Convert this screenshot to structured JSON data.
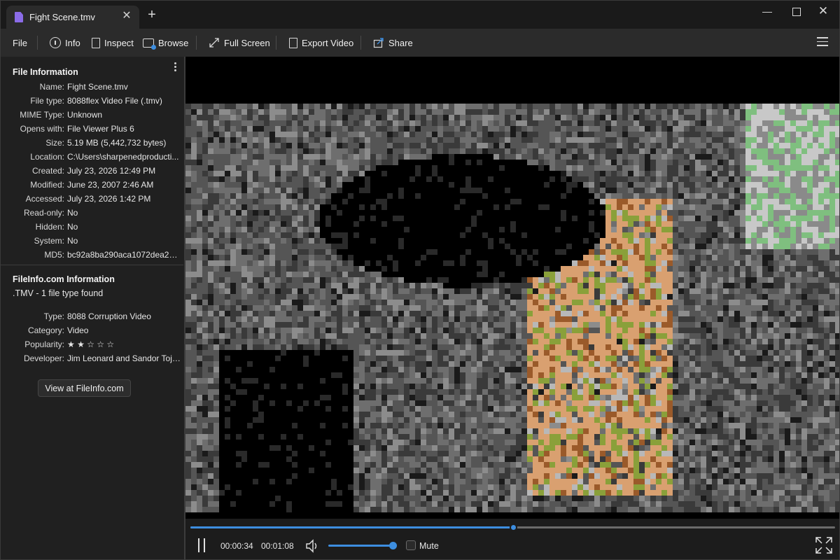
{
  "window": {
    "tab_title": "Fight Scene.tmv",
    "tab_close": "✕",
    "new_tab": "+",
    "minimize": "—",
    "close": "✕"
  },
  "toolbar": {
    "file": "File",
    "info": "Info",
    "inspect": "Inspect",
    "browse": "Browse",
    "full_screen": "Full Screen",
    "export_video": "Export Video",
    "share": "Share"
  },
  "file_info": {
    "title": "File Information",
    "rows": [
      {
        "key": "Name:",
        "value": "Fight Scene.tmv"
      },
      {
        "key": "File type:",
        "value": "8088flex Video File (.tmv)"
      },
      {
        "key": "MIME Type:",
        "value": "Unknown"
      },
      {
        "key": "Opens with:",
        "value": "File Viewer Plus 6"
      },
      {
        "key": "Size:",
        "value": "5.19 MB (5,442,732 bytes)"
      },
      {
        "key": "Location:",
        "value": "C:\\Users\\sharpenedproducti..."
      },
      {
        "key": "Created:",
        "value": "July 23, 2026 12:49 PM"
      },
      {
        "key": "Modified:",
        "value": "June 23, 2007 2:46 AM"
      },
      {
        "key": "Accessed:",
        "value": "July 23, 2026 1:42 PM"
      },
      {
        "key": "Read-only:",
        "value": "No"
      },
      {
        "key": "Hidden:",
        "value": "No"
      },
      {
        "key": "System:",
        "value": "No"
      },
      {
        "key": "MD5:",
        "value": "bc92a8ba290aca1072dea24cd..."
      }
    ]
  },
  "fileinfo_com": {
    "title": "FileInfo.com Information",
    "subtitle": ".TMV - 1 file type found",
    "rows": [
      {
        "key": "Type:",
        "value": "8088 Corruption Video"
      },
      {
        "key": "Category:",
        "value": "Video"
      },
      {
        "key": "Popularity:",
        "value": "★ ★ ☆ ☆ ☆"
      },
      {
        "key": "Developer:",
        "value": "Jim Leonard and Sandor Tojz..."
      }
    ],
    "button": "View at FileInfo.com"
  },
  "player": {
    "current_time": "00:00:34",
    "duration": "00:01:08",
    "progress": 0.5,
    "volume": 1.0,
    "mute_label": "Mute",
    "muted": false
  },
  "colors": {
    "accent": "#3d8ee0",
    "tab_icon": "#8b6ce8"
  }
}
